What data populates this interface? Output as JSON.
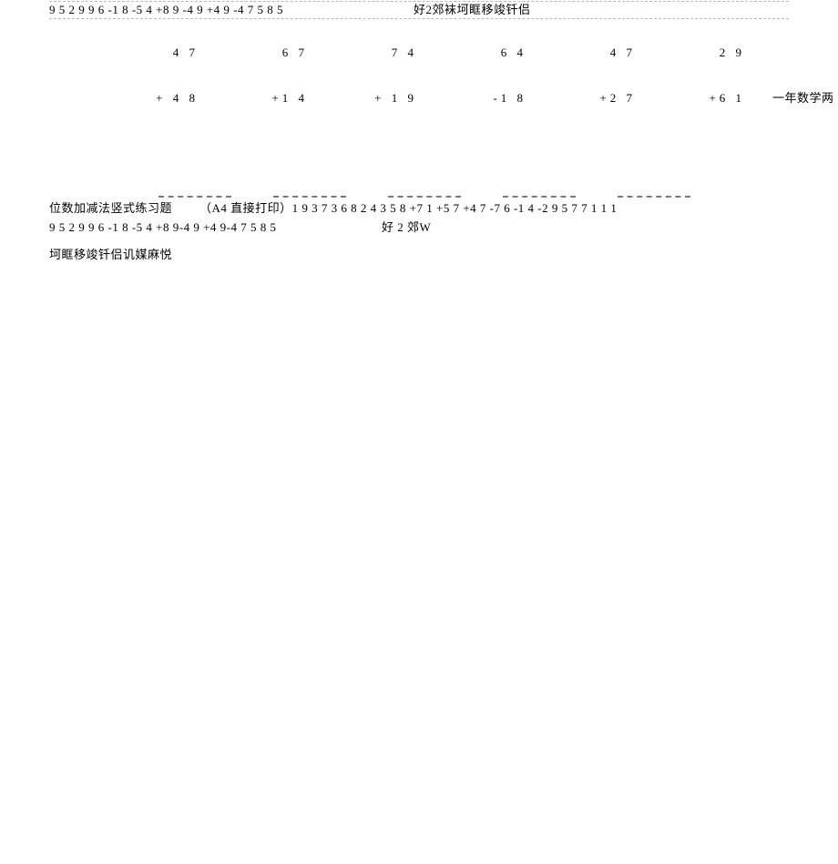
{
  "topDivider": {
    "leftSequence": "9 5 2 9 9 6 -1 8 -5 4 +8 9 -4 9 +4 9 -4 7 5 8 5",
    "rightNote": "好2郊袜坷眶移竣钎侣"
  },
  "problems": {
    "columns": [
      {
        "top": "4 7",
        "bottom": "+ 4 8"
      },
      {
        "top": "6 7",
        "bottom": "+1 4"
      },
      {
        "top": "7 4",
        "bottom": "+ 1 9"
      },
      {
        "top": "6 4",
        "bottom": "-1 8"
      },
      {
        "top": "4 7",
        "bottom": "+2 7"
      },
      {
        "top": "2 9",
        "bottom": "+6 1"
      }
    ],
    "annotation": "一年数学两"
  },
  "footer": {
    "line1a": "位数加减法竖式练习题",
    "line1b": "（A4 直接打印）1 9 3 7 3 6 8 2 4 3 5 8 +7 1 +5 7 +4 7 -7 6 -1 4 -2 9 5 7 7 1 1 1",
    "line2a": "9 5 2 9 9 6 -1 8 -5 4 +8 9-4 9 +4 9-4 7 5 8 5",
    "line2b": "好 2 郊W",
    "line3": "坷眶移竣钎侣讥媒麻悦"
  }
}
